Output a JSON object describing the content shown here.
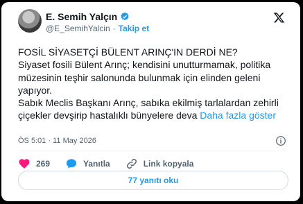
{
  "author": {
    "name": "E. Semih Yalçın",
    "handle": "@E_SemihYalcin",
    "separator": "·",
    "follow_label": "Takip et"
  },
  "tweet": {
    "lines": [
      "FOSİL SİYASETÇİ BÜLENT ARINÇ'IN DERDİ NE?",
      "Siyaset fosili Bülent Arınç; kendisini unutturmamak, politika müzesinin teşhir salonunda bulunmak için elinden geleni yapıyor.",
      "Sabık Meclis Başkanı Arınç, sabıka ekilmiş tarlalardan zehirli çiçekler devşirip hastalıklı bünyelere deva"
    ],
    "more_label": "Daha fazla göster",
    "timestamp": "ÖS 5:01 · 11 May 2026"
  },
  "actions": {
    "likes": "269",
    "reply_label": "Yanıtla",
    "copy_link_label": "Link kopyala"
  },
  "replies_button": "77 yanıtı oku",
  "colors": {
    "accent": "#1d9bf0",
    "like": "#f91880",
    "text": "#0f1419",
    "muted": "#536471"
  },
  "icons": [
    "verified-badge-icon",
    "x-logo-icon",
    "info-icon",
    "heart-icon",
    "reply-icon",
    "link-icon"
  ]
}
